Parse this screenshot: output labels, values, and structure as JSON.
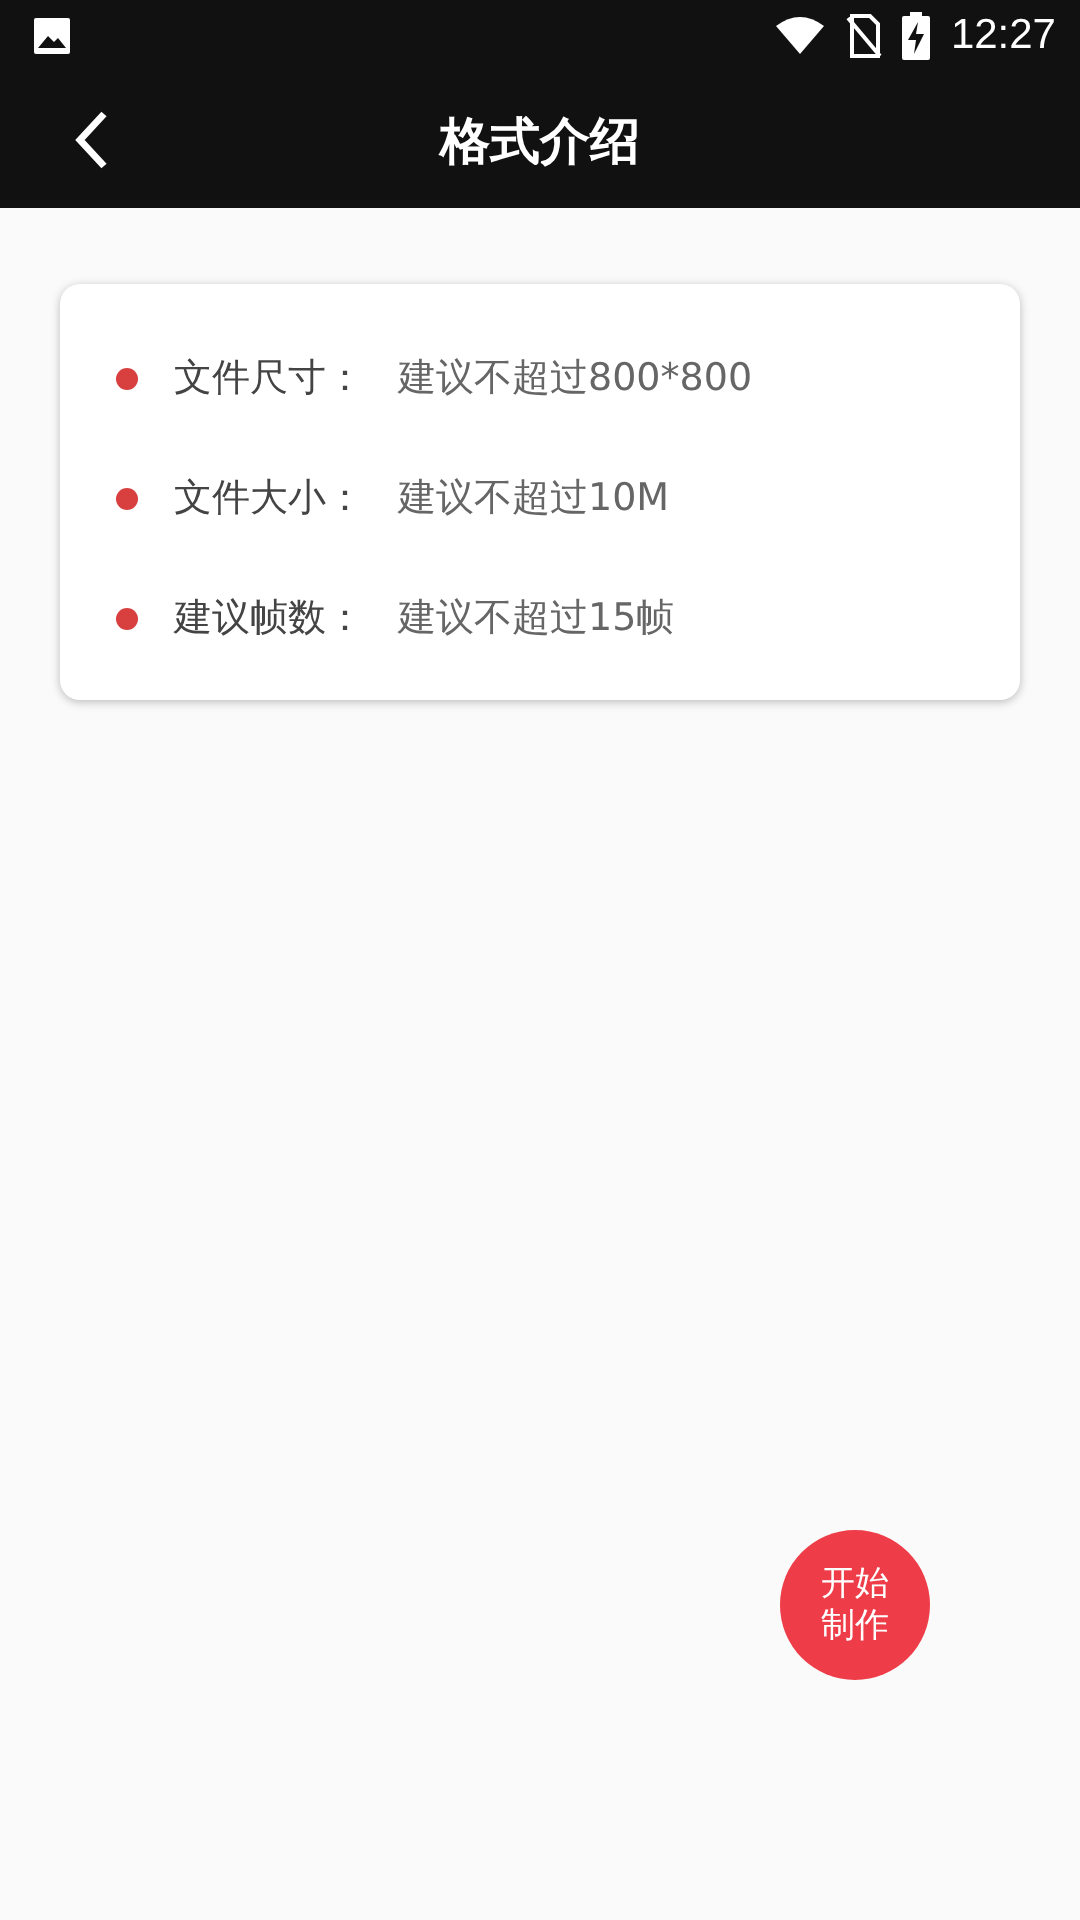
{
  "status_bar": {
    "time": "12:27"
  },
  "app_bar": {
    "title": "格式介绍"
  },
  "format_items": [
    {
      "label": "文件尺寸：",
      "value": "建议不超过800*800"
    },
    {
      "label": "文件大小：",
      "value": "建议不超过10M"
    },
    {
      "label": "建议帧数：",
      "value": "建议不超过15帧"
    }
  ],
  "fab": {
    "lines": [
      "开始",
      "制作"
    ]
  }
}
